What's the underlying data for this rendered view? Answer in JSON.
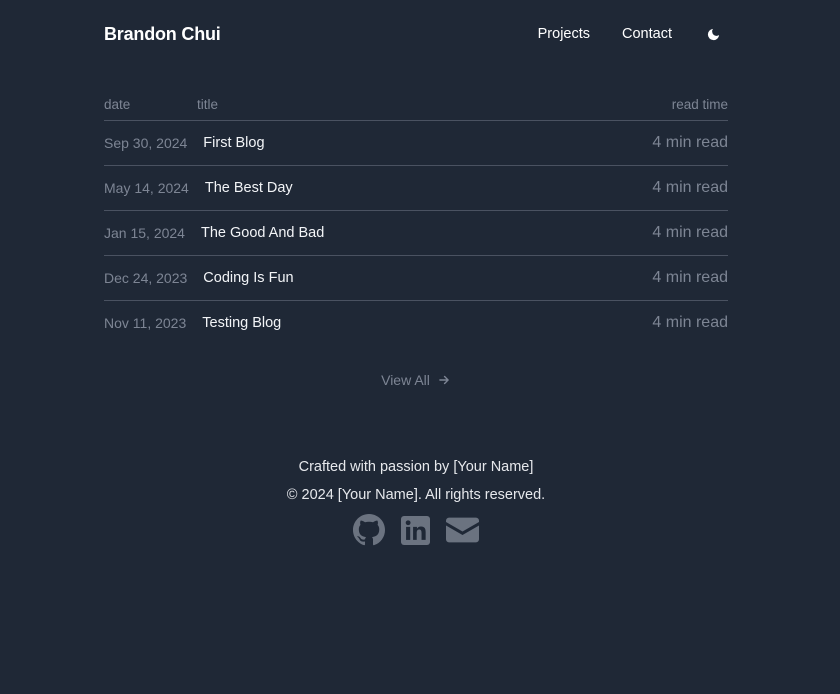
{
  "header": {
    "brand": "Brandon Chui",
    "nav": [
      "Projects",
      "Contact"
    ],
    "theme_icon": "moon-icon"
  },
  "table": {
    "columns": {
      "date": "date",
      "title": "title",
      "read_time": "read time"
    },
    "rows": [
      {
        "date": "Sep 30, 2024",
        "title": "First Blog",
        "read_time": "4 min read"
      },
      {
        "date": "May 14, 2024",
        "title": "The Best Day",
        "read_time": "4 min read"
      },
      {
        "date": "Jan 15, 2024",
        "title": "The Good And Bad",
        "read_time": "4 min read"
      },
      {
        "date": "Dec 24, 2023",
        "title": "Coding Is Fun",
        "read_time": "4 min read"
      },
      {
        "date": "Nov 11, 2023",
        "title": "Testing Blog",
        "read_time": "4 min read"
      }
    ]
  },
  "view_all": {
    "label": "View All",
    "icon": "arrow-right-icon"
  },
  "footer": {
    "credit": "Crafted with passion by [Your Name]",
    "copyright": "© 2024 [Your Name]. All rights reserved.",
    "social_icons": [
      "github-icon",
      "linkedin-icon",
      "mail-icon"
    ]
  },
  "colors": {
    "background": "#1f2836",
    "text": "#ffffff",
    "muted": "#7d8594",
    "divider": "#4a5261",
    "icon": "#6b7380"
  }
}
